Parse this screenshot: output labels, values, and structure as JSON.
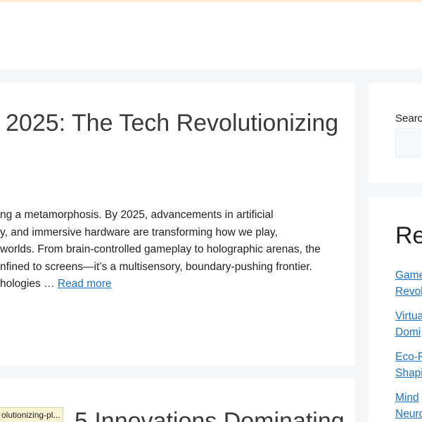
{
  "colors": {
    "link": "#1e73be",
    "page_background": "#f5f6f8",
    "card_background": "#ffffff",
    "top_strip": "#fdebd3"
  },
  "posts": [
    {
      "title": "2025: The Tech Revolutionizing",
      "excerpt_lines": [
        "ng a metamorphosis. By 2025, advancements in artificial",
        "y, and immersive hardware are transforming how we play,",
        "worlds. From brain-controlled gameplay to holographic arenas, the",
        "nfined to screens—it’s a multisensory, boundary-pushing frontier."
      ],
      "excerpt_tail": "hologies … ",
      "read_more": "Read more"
    },
    {
      "title": "5 Innovations Dominating"
    }
  ],
  "sidebar": {
    "search": {
      "label": "Searc",
      "placeholder": ""
    },
    "recent": {
      "title": "Re",
      "items": [
        [
          "Game",
          "Revol"
        ],
        [
          "Virtua",
          "Domi"
        ],
        [
          "Eco-F",
          "Shapi"
        ],
        [
          "Mind",
          "Neuro"
        ]
      ]
    }
  },
  "status_bar": {
    "url": "olutionizing-pl..."
  }
}
